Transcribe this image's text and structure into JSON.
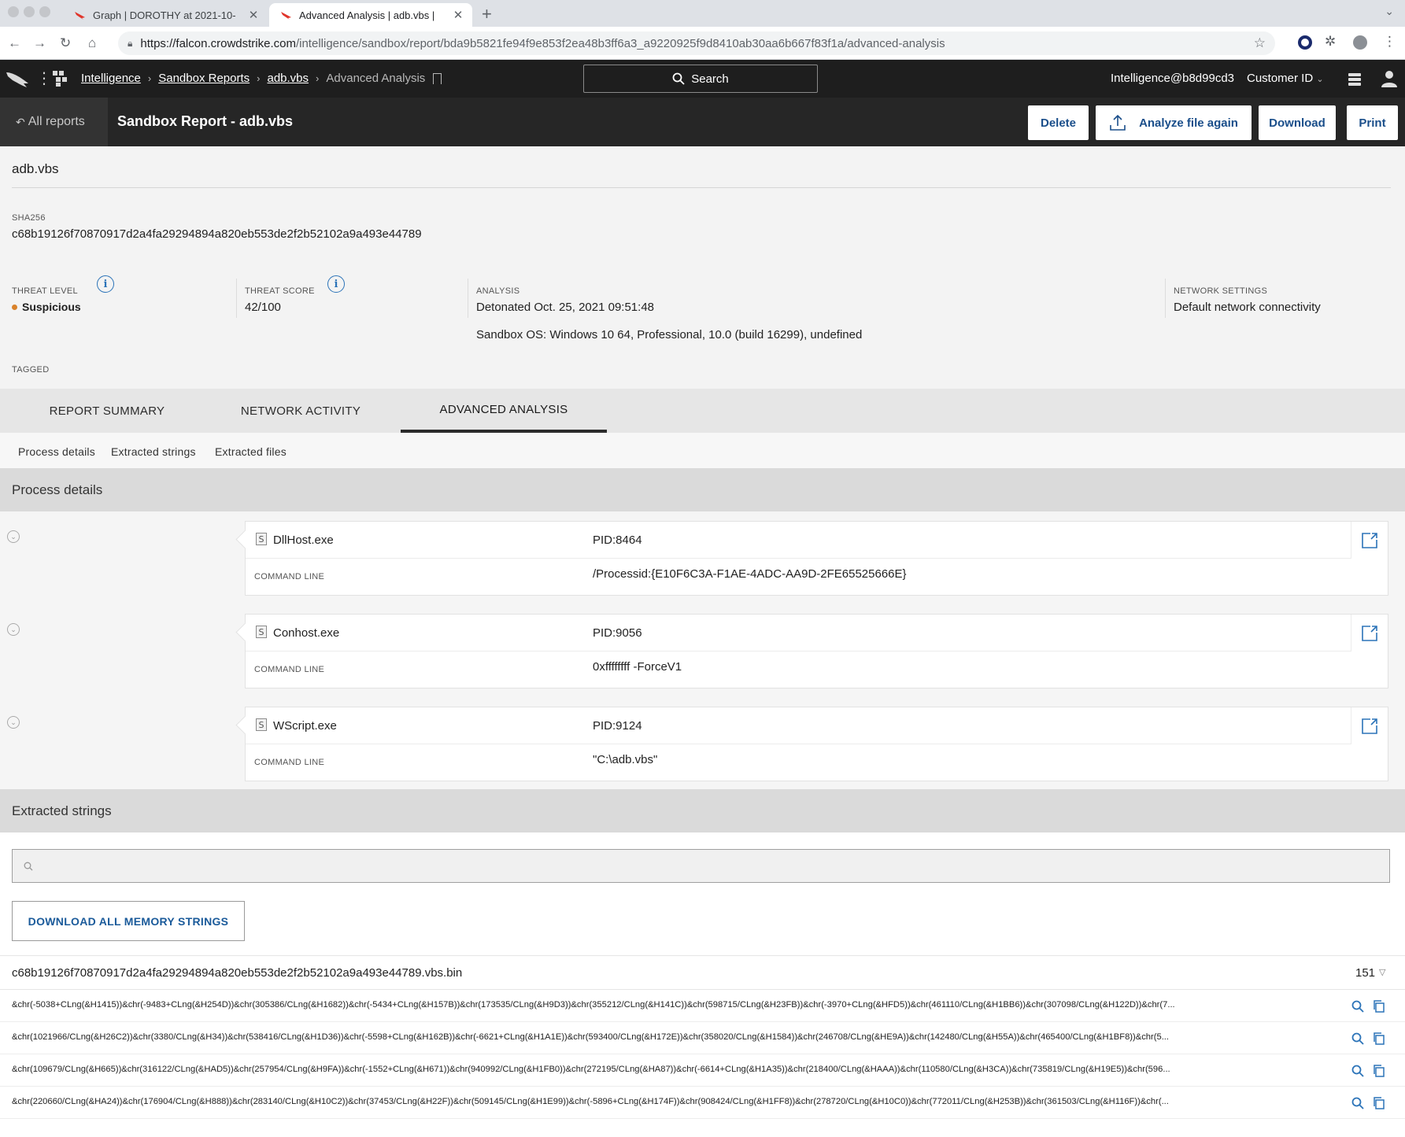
{
  "browser": {
    "tabs": [
      {
        "title": "Graph | DOROTHY at 2021-10-"
      },
      {
        "title": "Advanced Analysis | adb.vbs |"
      }
    ],
    "url_host": "https://falcon.crowdstrike.com",
    "url_path": "/intelligence/sandbox/report/bda9b5821fe94f9e853f2ea48b3ff6a3_a9220925f9d8410ab30aa6b667f83f1a/advanced-analysis"
  },
  "appbar": {
    "breadcrumbs": [
      "Intelligence",
      "Sandbox Reports",
      "adb.vbs"
    ],
    "current": "Advanced Analysis",
    "search_label": "Search",
    "user": "Intelligence@b8d99cd3",
    "customer": "Customer ID"
  },
  "reportbar": {
    "all_reports": "All reports",
    "title": "Sandbox Report - adb.vbs",
    "delete": "Delete",
    "analyze": "Analyze file again",
    "download": "Download",
    "print": "Print"
  },
  "meta": {
    "filename": "adb.vbs",
    "sha_label": "SHA256",
    "sha": "c68b19126f70870917d2a4fa29294894a820eb553de2f2b52102a9a493e44789",
    "threat_level_label": "THREAT LEVEL",
    "threat_level": "Suspicious",
    "threat_score_label": "THREAT SCORE",
    "threat_score": "42/100",
    "analysis_label": "ANALYSIS",
    "detonated": "Detonated Oct. 25, 2021 09:51:48",
    "sandbox_os": "Sandbox OS: Windows 10 64, Professional, 10.0 (build 16299), undefined",
    "network_label": "NETWORK SETTINGS",
    "network": "Default network connectivity",
    "tagged_label": "TAGGED"
  },
  "tabs": [
    "REPORT SUMMARY",
    "NETWORK ACTIVITY",
    "ADVANCED ANALYSIS"
  ],
  "subnav": [
    "Process details",
    "Extracted strings",
    "Extracted files"
  ],
  "process_details": {
    "heading": "Process details",
    "cmd_label": "COMMAND LINE",
    "processes": [
      {
        "name": "DllHost.exe",
        "pid": "PID:8464",
        "cmd": "/Processid:{E10F6C3A-F1AE-4ADC-AA9D-2FE65525666E}"
      },
      {
        "name": "Conhost.exe",
        "pid": "PID:9056",
        "cmd": "0xffffffff -ForceV1"
      },
      {
        "name": "WScript.exe",
        "pid": "PID:9124",
        "cmd": "\"C:\\adb.vbs\""
      }
    ]
  },
  "extracted_strings": {
    "heading": "Extracted strings",
    "search_placeholder": "",
    "download_all": "DOWNLOAD ALL MEMORY STRINGS",
    "bin_name": "c68b19126f70870917d2a4fa29294894a820eb553de2f2b52102a9a493e44789.vbs.bin",
    "bin_count": "151",
    "rows": [
      "&chr(-5038+CLng(&H1415))&chr(-9483+CLng(&H254D))&chr(305386/CLng(&H1682))&chr(-5434+CLng(&H157B))&chr(173535/CLng(&H9D3))&chr(355212/CLng(&H141C))&chr(598715/CLng(&H23FB))&chr(-3970+CLng(&HFD5))&chr(461110/CLng(&H1BB6))&chr(307098/CLng(&H122D))&chr(7...",
      "&chr(1021966/CLng(&H26C2))&chr(3380/CLng(&H34))&chr(538416/CLng(&H1D36))&chr(-5598+CLng(&H162B))&chr(-6621+CLng(&H1A1E))&chr(593400/CLng(&H172E))&chr(358020/CLng(&H1584))&chr(246708/CLng(&HE9A))&chr(142480/CLng(&H55A))&chr(465400/CLng(&H1BF8))&chr(5...",
      "&chr(109679/CLng(&H665))&chr(316122/CLng(&HAD5))&chr(257954/CLng(&H9FA))&chr(-1552+CLng(&H671))&chr(940992/CLng(&H1FB0))&chr(272195/CLng(&HA87))&chr(-6614+CLng(&H1A35))&chr(218400/CLng(&HAAA))&chr(110580/CLng(&H3CA))&chr(735819/CLng(&H19E5))&chr(596...",
      "&chr(220660/CLng(&HA24))&chr(176904/CLng(&H888))&chr(283140/CLng(&H10C2))&chr(37453/CLng(&H22F))&chr(509145/CLng(&H1E99))&chr(-5896+CLng(&H174F))&chr(908424/CLng(&H1FF8))&chr(278720/CLng(&H10C0))&chr(772011/CLng(&H253B))&chr(361503/CLng(&H116F))&chr(..."
    ]
  }
}
